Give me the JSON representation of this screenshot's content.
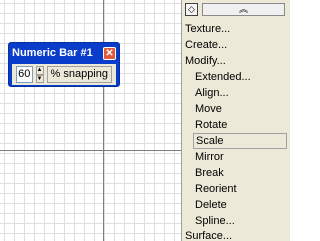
{
  "numeric_bar": {
    "title": "Numeric Bar #1",
    "close_glyph": "✕",
    "value": "60",
    "label": "% snapping"
  },
  "panel": {
    "collapse_glyph": "◇",
    "expand_glyph": "︽",
    "items": {
      "texture": "Texture...",
      "create": "Create...",
      "modify": "Modify...",
      "extended": "Extended...",
      "align": "Align...",
      "move": "Move",
      "rotate": "Rotate",
      "scale": "Scale",
      "mirror": "Mirror",
      "break": "Break",
      "reorient": "Reorient",
      "delete": "Delete",
      "spline": "Spline...",
      "surface": "Surface..."
    }
  }
}
